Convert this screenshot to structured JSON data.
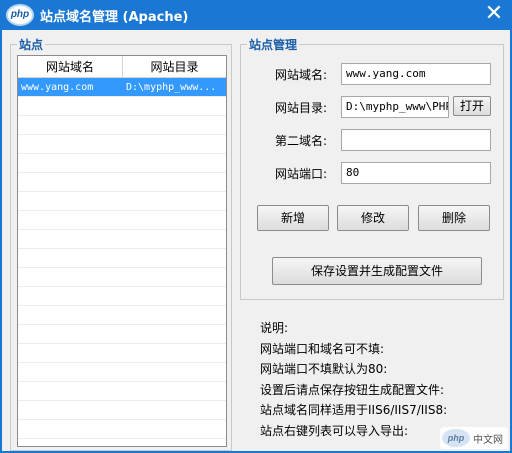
{
  "window": {
    "title": "站点域名管理 (Apache)",
    "logo_text": "php",
    "close_glyph": "✕"
  },
  "site_group": {
    "title": "站点",
    "columns": [
      "网站域名",
      "网站目录"
    ],
    "rows": [
      {
        "domain": "www.yang.com",
        "dir": "D:\\myphp_www...",
        "selected": true
      }
    ]
  },
  "manage_group": {
    "title": "站点管理",
    "domain_label": "网站域名:",
    "domain_value": "www.yang.com",
    "dir_label": "网站目录:",
    "dir_value": "D:\\myphp_www\\PHPT",
    "open_button": "打开",
    "second_domain_label": "第二域名:",
    "second_domain_value": "",
    "port_label": "网站端口:",
    "port_value": "80",
    "add_button": "新增",
    "edit_button": "修改",
    "delete_button": "删除",
    "save_button": "保存设置并生成配置文件"
  },
  "notes": [
    "说明:",
    "网站端口和域名可不填:",
    "网站端口不填默认为80:",
    "设置后请点保存按钮生成配置文件:",
    "站点域名同样适用于IIS6/IIS7/IIS8:",
    "站点右键列表可以导入导出:"
  ],
  "watermark": {
    "logo_text": "php",
    "text": "中文网"
  },
  "colors": {
    "titlebar": "#1a78d4",
    "selection": "#3399ff",
    "group_title": "#1a5ea8"
  }
}
